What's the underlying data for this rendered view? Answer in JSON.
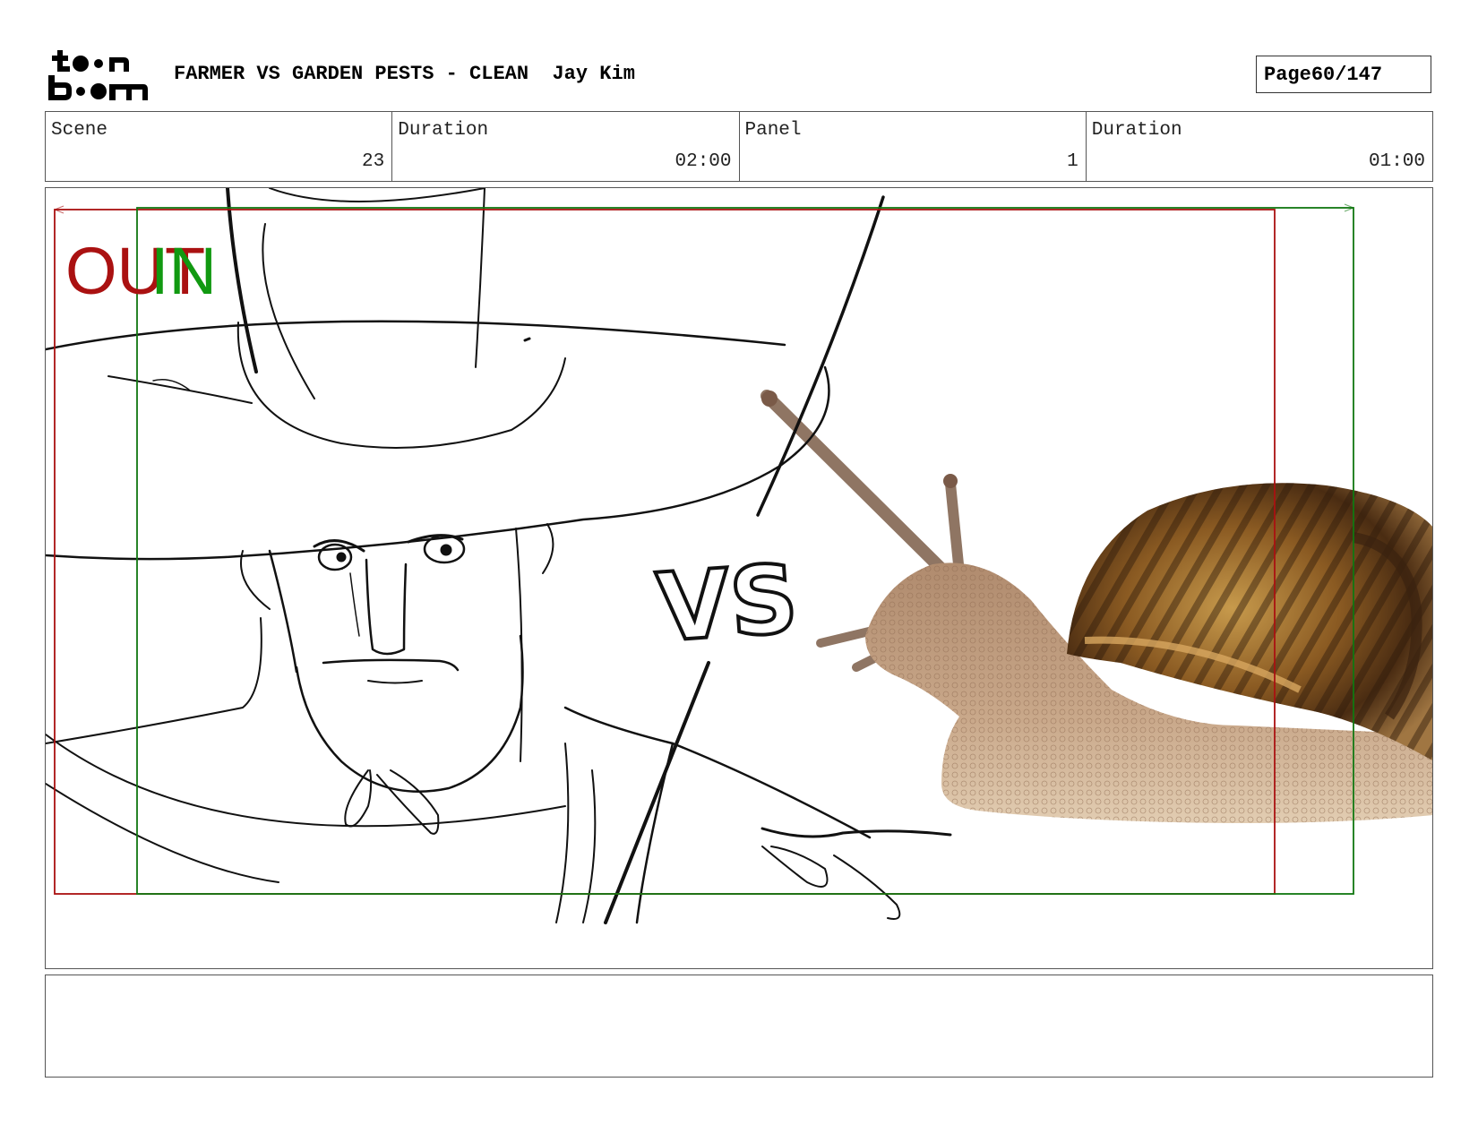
{
  "header": {
    "title": "FARMER VS GARDEN PESTS - CLEAN",
    "author": "Jay Kim",
    "page_label": "Page",
    "page_number": "60/147"
  },
  "info": {
    "scene_label": "Scene",
    "scene_value": "23",
    "scene_duration_label": "Duration",
    "scene_duration_value": "02:00",
    "panel_label": "Panel",
    "panel_value": "1",
    "panel_duration_label": "Duration",
    "panel_duration_value": "01:00"
  },
  "panel": {
    "out_label": "OUT",
    "in_label": "IN",
    "vs_text": "VS"
  },
  "logo": {
    "text_top": "toon",
    "text_bottom": "boom"
  },
  "colors": {
    "out_frame": "#aa1111",
    "in_frame": "#117711"
  },
  "dialog": {
    "text": ""
  }
}
